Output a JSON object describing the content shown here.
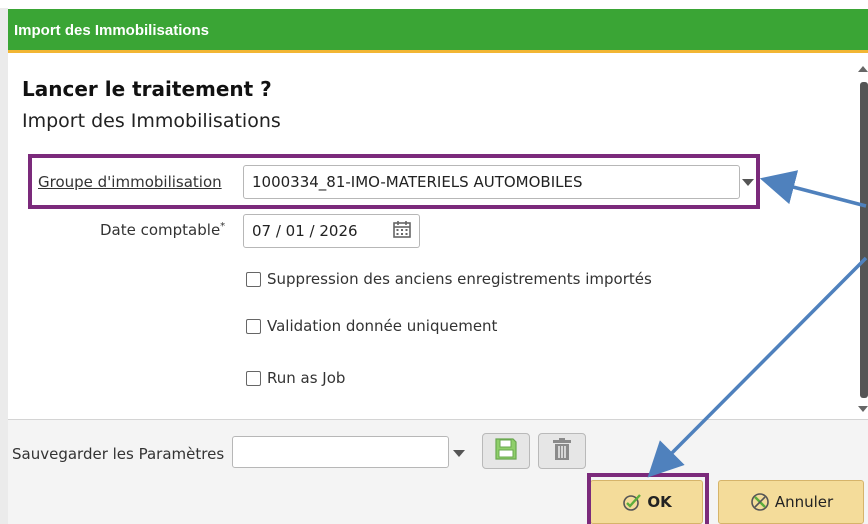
{
  "dialog": {
    "title": "Import des Immobilisations",
    "heading": "Lancer le traitement ?",
    "subheading": "Import des Immobilisations"
  },
  "form": {
    "groupe_label": "Groupe d'immobilisation",
    "groupe_value": "1000334_81-IMO-MATERIELS AUTOMOBILES",
    "date_label": "Date comptable",
    "date_required_mark": "*",
    "date_value": "07 / 01 / 2026",
    "checkboxes": [
      {
        "label": "Suppression des anciens enregistrements importés",
        "checked": false
      },
      {
        "label": "Validation donnée uniquement",
        "checked": false
      },
      {
        "label": "Run as Job",
        "checked": false
      }
    ]
  },
  "footer": {
    "save_params_label": "Sauvegarder les Paramètres",
    "save_params_value": "",
    "ok_label": "OK",
    "cancel_label": "Annuler"
  },
  "icons": {
    "calendar": "calendar-icon",
    "save": "floppy-disk-icon",
    "delete": "trash-icon",
    "ok": "check-circle-icon",
    "cancel": "cancel-circle-icon"
  },
  "colors": {
    "titlebar": "#3aa535",
    "titlebar_accent": "#f2b634",
    "button": "#f4dc9a",
    "highlight": "#7b2a7b",
    "annotation_arrow": "#4f81bd"
  }
}
